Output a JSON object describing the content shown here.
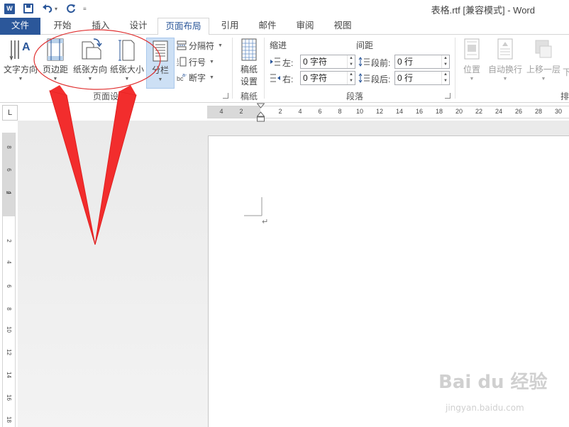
{
  "window": {
    "title": "表格.rtf [兼容模式] - Word"
  },
  "qat": {
    "app_icon": "W"
  },
  "tabs": [
    {
      "label": "文件"
    },
    {
      "label": "开始"
    },
    {
      "label": "插入"
    },
    {
      "label": "设计"
    },
    {
      "label": "页面布局"
    },
    {
      "label": "引用"
    },
    {
      "label": "邮件"
    },
    {
      "label": "审阅"
    },
    {
      "label": "视图"
    }
  ],
  "ribbon": {
    "page_setup": {
      "text_direction": "文字方向",
      "margins": "页边距",
      "orientation": "纸张方向",
      "size": "纸张大小",
      "columns": "分栏",
      "breaks": "分隔符",
      "line_numbers": "行号",
      "hyphenation": "断字",
      "group_label": "页面设置"
    },
    "manuscript": {
      "button": "稿纸\n设置",
      "button_line1": "稿纸",
      "button_line2": "设置",
      "group_label": "稿纸"
    },
    "paragraph": {
      "indent_header": "缩进",
      "spacing_header": "间距",
      "left_label": "左:",
      "right_label": "右:",
      "left_value": "0 字符",
      "right_value": "0 字符",
      "before_label": "段前:",
      "after_label": "段后:",
      "before_value": "0 行",
      "after_value": "0 行",
      "group_label": "段落"
    },
    "arrange": {
      "position": "位置",
      "wrap_text": "自动换行",
      "bring_forward": "上移一层",
      "send_backward": "下",
      "group_label": "排"
    }
  },
  "hruler": {
    "labels": [
      "4",
      "2",
      "2",
      "4",
      "6",
      "8",
      "10",
      "12",
      "14",
      "16",
      "18",
      "20",
      "22",
      "24",
      "26",
      "28",
      "30"
    ]
  },
  "vruler": {
    "labels": [
      "8",
      "6",
      "4",
      "2",
      "2",
      "4",
      "6",
      "8",
      "10",
      "12",
      "14",
      "16",
      "18"
    ]
  },
  "ruler_corner": "L",
  "watermark": {
    "main": "Bai du 经验",
    "sub": "jingyan.baidu.com"
  }
}
